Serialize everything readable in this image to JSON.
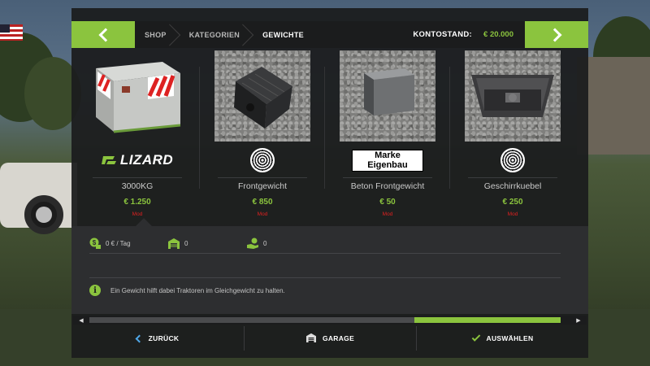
{
  "breadcrumb": [
    "SHOP",
    "KATEGORIEN",
    "GEWICHTE"
  ],
  "balance": {
    "label": "KONTOSTAND:",
    "value": "€ 20.000"
  },
  "items": [
    {
      "name": "3000KG",
      "price": "€ 1.250",
      "tag": "Mod",
      "brand": "LIZARD",
      "brand_type": "logo-text"
    },
    {
      "name": "Frontgewicht",
      "price": "€ 850",
      "tag": "Mod",
      "brand_type": "fingerprint-icon"
    },
    {
      "name": "Beton Frontgewicht",
      "price": "€ 50",
      "tag": "Mod",
      "brand_line1": "Marke",
      "brand_line2": "Eigenbau",
      "brand_type": "label-box"
    },
    {
      "name": "Geschirrkuebel",
      "price": "€ 250",
      "tag": "Mod",
      "brand_type": "fingerprint-icon"
    }
  ],
  "details": {
    "stats": [
      {
        "icon": "dollar-coins-icon",
        "value": "0 € / Tag"
      },
      {
        "icon": "garage-icon",
        "value": "0"
      },
      {
        "icon": "hand-money-icon",
        "value": "0"
      }
    ],
    "info": "Ein Gewicht hilft dabei Traktoren im Gleichgewicht zu halten."
  },
  "scroll": {
    "position_fraction": 1.0,
    "visible_fraction": 0.31
  },
  "buttons": {
    "back": "ZURÜCK",
    "garage": "GARAGE",
    "select": "AUSWÄHLEN"
  },
  "colors": {
    "accent": "#8bc43e",
    "price_green": "#8bc43e",
    "mod_red": "#e02020",
    "back_blue": "#4fa7e8"
  }
}
